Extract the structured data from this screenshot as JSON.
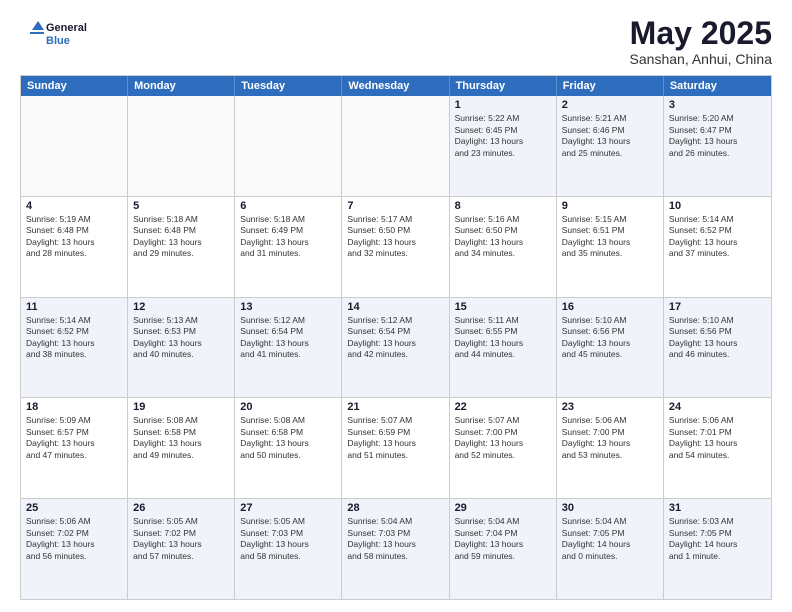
{
  "header": {
    "logo_general": "General",
    "logo_blue": "Blue",
    "month_title": "May 2025",
    "subtitle": "Sanshan, Anhui, China"
  },
  "calendar": {
    "days_of_week": [
      "Sunday",
      "Monday",
      "Tuesday",
      "Wednesday",
      "Thursday",
      "Friday",
      "Saturday"
    ],
    "rows": [
      {
        "cells": [
          {
            "day": "",
            "empty": true,
            "lines": []
          },
          {
            "day": "",
            "empty": true,
            "lines": []
          },
          {
            "day": "",
            "empty": true,
            "lines": []
          },
          {
            "day": "",
            "empty": true,
            "lines": []
          },
          {
            "day": "1",
            "empty": false,
            "lines": [
              "Sunrise: 5:22 AM",
              "Sunset: 6:45 PM",
              "Daylight: 13 hours",
              "and 23 minutes."
            ]
          },
          {
            "day": "2",
            "empty": false,
            "lines": [
              "Sunrise: 5:21 AM",
              "Sunset: 6:46 PM",
              "Daylight: 13 hours",
              "and 25 minutes."
            ]
          },
          {
            "day": "3",
            "empty": false,
            "lines": [
              "Sunrise: 5:20 AM",
              "Sunset: 6:47 PM",
              "Daylight: 13 hours",
              "and 26 minutes."
            ]
          }
        ]
      },
      {
        "cells": [
          {
            "day": "4",
            "empty": false,
            "lines": [
              "Sunrise: 5:19 AM",
              "Sunset: 6:48 PM",
              "Daylight: 13 hours",
              "and 28 minutes."
            ]
          },
          {
            "day": "5",
            "empty": false,
            "lines": [
              "Sunrise: 5:18 AM",
              "Sunset: 6:48 PM",
              "Daylight: 13 hours",
              "and 29 minutes."
            ]
          },
          {
            "day": "6",
            "empty": false,
            "lines": [
              "Sunrise: 5:18 AM",
              "Sunset: 6:49 PM",
              "Daylight: 13 hours",
              "and 31 minutes."
            ]
          },
          {
            "day": "7",
            "empty": false,
            "lines": [
              "Sunrise: 5:17 AM",
              "Sunset: 6:50 PM",
              "Daylight: 13 hours",
              "and 32 minutes."
            ]
          },
          {
            "day": "8",
            "empty": false,
            "lines": [
              "Sunrise: 5:16 AM",
              "Sunset: 6:50 PM",
              "Daylight: 13 hours",
              "and 34 minutes."
            ]
          },
          {
            "day": "9",
            "empty": false,
            "lines": [
              "Sunrise: 5:15 AM",
              "Sunset: 6:51 PM",
              "Daylight: 13 hours",
              "and 35 minutes."
            ]
          },
          {
            "day": "10",
            "empty": false,
            "lines": [
              "Sunrise: 5:14 AM",
              "Sunset: 6:52 PM",
              "Daylight: 13 hours",
              "and 37 minutes."
            ]
          }
        ]
      },
      {
        "cells": [
          {
            "day": "11",
            "empty": false,
            "lines": [
              "Sunrise: 5:14 AM",
              "Sunset: 6:52 PM",
              "Daylight: 13 hours",
              "and 38 minutes."
            ]
          },
          {
            "day": "12",
            "empty": false,
            "lines": [
              "Sunrise: 5:13 AM",
              "Sunset: 6:53 PM",
              "Daylight: 13 hours",
              "and 40 minutes."
            ]
          },
          {
            "day": "13",
            "empty": false,
            "lines": [
              "Sunrise: 5:12 AM",
              "Sunset: 6:54 PM",
              "Daylight: 13 hours",
              "and 41 minutes."
            ]
          },
          {
            "day": "14",
            "empty": false,
            "lines": [
              "Sunrise: 5:12 AM",
              "Sunset: 6:54 PM",
              "Daylight: 13 hours",
              "and 42 minutes."
            ]
          },
          {
            "day": "15",
            "empty": false,
            "lines": [
              "Sunrise: 5:11 AM",
              "Sunset: 6:55 PM",
              "Daylight: 13 hours",
              "and 44 minutes."
            ]
          },
          {
            "day": "16",
            "empty": false,
            "lines": [
              "Sunrise: 5:10 AM",
              "Sunset: 6:56 PM",
              "Daylight: 13 hours",
              "and 45 minutes."
            ]
          },
          {
            "day": "17",
            "empty": false,
            "lines": [
              "Sunrise: 5:10 AM",
              "Sunset: 6:56 PM",
              "Daylight: 13 hours",
              "and 46 minutes."
            ]
          }
        ]
      },
      {
        "cells": [
          {
            "day": "18",
            "empty": false,
            "lines": [
              "Sunrise: 5:09 AM",
              "Sunset: 6:57 PM",
              "Daylight: 13 hours",
              "and 47 minutes."
            ]
          },
          {
            "day": "19",
            "empty": false,
            "lines": [
              "Sunrise: 5:08 AM",
              "Sunset: 6:58 PM",
              "Daylight: 13 hours",
              "and 49 minutes."
            ]
          },
          {
            "day": "20",
            "empty": false,
            "lines": [
              "Sunrise: 5:08 AM",
              "Sunset: 6:58 PM",
              "Daylight: 13 hours",
              "and 50 minutes."
            ]
          },
          {
            "day": "21",
            "empty": false,
            "lines": [
              "Sunrise: 5:07 AM",
              "Sunset: 6:59 PM",
              "Daylight: 13 hours",
              "and 51 minutes."
            ]
          },
          {
            "day": "22",
            "empty": false,
            "lines": [
              "Sunrise: 5:07 AM",
              "Sunset: 7:00 PM",
              "Daylight: 13 hours",
              "and 52 minutes."
            ]
          },
          {
            "day": "23",
            "empty": false,
            "lines": [
              "Sunrise: 5:06 AM",
              "Sunset: 7:00 PM",
              "Daylight: 13 hours",
              "and 53 minutes."
            ]
          },
          {
            "day": "24",
            "empty": false,
            "lines": [
              "Sunrise: 5:06 AM",
              "Sunset: 7:01 PM",
              "Daylight: 13 hours",
              "and 54 minutes."
            ]
          }
        ]
      },
      {
        "cells": [
          {
            "day": "25",
            "empty": false,
            "lines": [
              "Sunrise: 5:06 AM",
              "Sunset: 7:02 PM",
              "Daylight: 13 hours",
              "and 56 minutes."
            ]
          },
          {
            "day": "26",
            "empty": false,
            "lines": [
              "Sunrise: 5:05 AM",
              "Sunset: 7:02 PM",
              "Daylight: 13 hours",
              "and 57 minutes."
            ]
          },
          {
            "day": "27",
            "empty": false,
            "lines": [
              "Sunrise: 5:05 AM",
              "Sunset: 7:03 PM",
              "Daylight: 13 hours",
              "and 58 minutes."
            ]
          },
          {
            "day": "28",
            "empty": false,
            "lines": [
              "Sunrise: 5:04 AM",
              "Sunset: 7:03 PM",
              "Daylight: 13 hours",
              "and 58 minutes."
            ]
          },
          {
            "day": "29",
            "empty": false,
            "lines": [
              "Sunrise: 5:04 AM",
              "Sunset: 7:04 PM",
              "Daylight: 13 hours",
              "and 59 minutes."
            ]
          },
          {
            "day": "30",
            "empty": false,
            "lines": [
              "Sunrise: 5:04 AM",
              "Sunset: 7:05 PM",
              "Daylight: 14 hours",
              "and 0 minutes."
            ]
          },
          {
            "day": "31",
            "empty": false,
            "lines": [
              "Sunrise: 5:03 AM",
              "Sunset: 7:05 PM",
              "Daylight: 14 hours",
              "and 1 minute."
            ]
          }
        ]
      }
    ]
  }
}
